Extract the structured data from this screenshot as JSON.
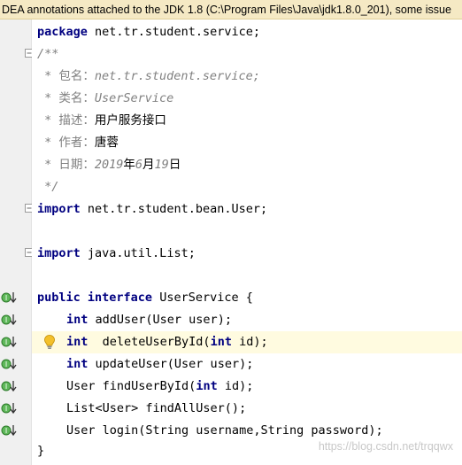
{
  "banner": {
    "text": "DEA annotations attached to the JDK 1.8 (C:\\Program Files\\Java\\jdk1.8.0_201), some issue"
  },
  "code": {
    "package_kw": "package",
    "package_name": " net.tr.student.service;",
    "doc_open": "/**",
    "doc_star": " * ",
    "doc_pkg_label": "包名：",
    "doc_pkg_value": "net.tr.student.service;",
    "doc_class_label": "类名：",
    "doc_class_value": "UserService",
    "doc_desc_label": "描述：",
    "doc_desc_value": "用户服务接口",
    "doc_author_label": "作者：",
    "doc_author_value": "唐蓉",
    "doc_date_label": "日期：",
    "doc_date_year": "2019",
    "doc_date_yr_cn": "年",
    "doc_date_month": "6",
    "doc_date_mo_cn": "月",
    "doc_date_day": "19",
    "doc_date_day_cn": "日",
    "doc_close": " */",
    "import_kw": "import",
    "import1_name": " net.tr.student.bean.User;",
    "import2_name": " java.util.List;",
    "public_kw": "public",
    "interface_kw": " interface",
    "interface_name": " UserService {",
    "int_kw": "int",
    "add_user": " addUser(User user);",
    "delete_name": "  deleteUserById(",
    "delete_tail": " id);",
    "update_user": " updateUser(User user);",
    "find_by_id_pre": "User findUserById(",
    "find_by_id_tail": " id);",
    "find_all": "List<User> findAllUser();",
    "login": "User login(String username,String password);",
    "closing_brace": "}"
  },
  "watermark": "https://blog.csdn.net/trqqwx",
  "colors": {
    "keyword": "#000080",
    "comment": "#808080",
    "highlight_line": "#fffbe0",
    "banner_bg": "#f5e9c4",
    "gutter_bg": "#f0f0f0",
    "implement_icon": "#3d9a3a"
  },
  "gutter_icons": [
    "implemented-method-icon",
    "fold-marker-icon",
    "intention-bulb-icon"
  ]
}
